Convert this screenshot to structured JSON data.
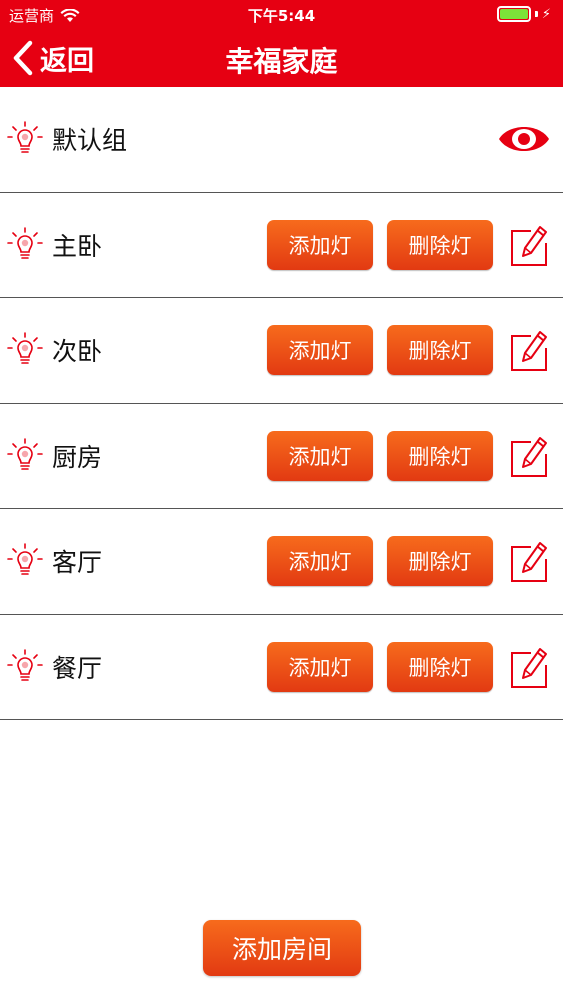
{
  "status_bar": {
    "carrier": "运营商",
    "time": "下午5:44",
    "battery_level": 1.0
  },
  "nav": {
    "back_label": "返回",
    "title": "幸福家庭"
  },
  "colors": {
    "accent": "#e60012",
    "button": "#ed5116"
  },
  "rooms": [
    {
      "label": "默认组",
      "action_icon": "eye-icon"
    },
    {
      "label": "主卧",
      "add_label": "添加灯",
      "delete_label": "删除灯",
      "action_icon": "edit-icon"
    },
    {
      "label": "次卧",
      "add_label": "添加灯",
      "delete_label": "删除灯",
      "action_icon": "edit-icon"
    },
    {
      "label": "厨房",
      "add_label": "添加灯",
      "delete_label": "删除灯",
      "action_icon": "edit-icon"
    },
    {
      "label": "客厅",
      "add_label": "添加灯",
      "delete_label": "删除灯",
      "action_icon": "edit-icon"
    },
    {
      "label": "餐厅",
      "add_label": "添加灯",
      "delete_label": "删除灯",
      "action_icon": "edit-icon"
    }
  ],
  "add_room_label": "添加房间"
}
